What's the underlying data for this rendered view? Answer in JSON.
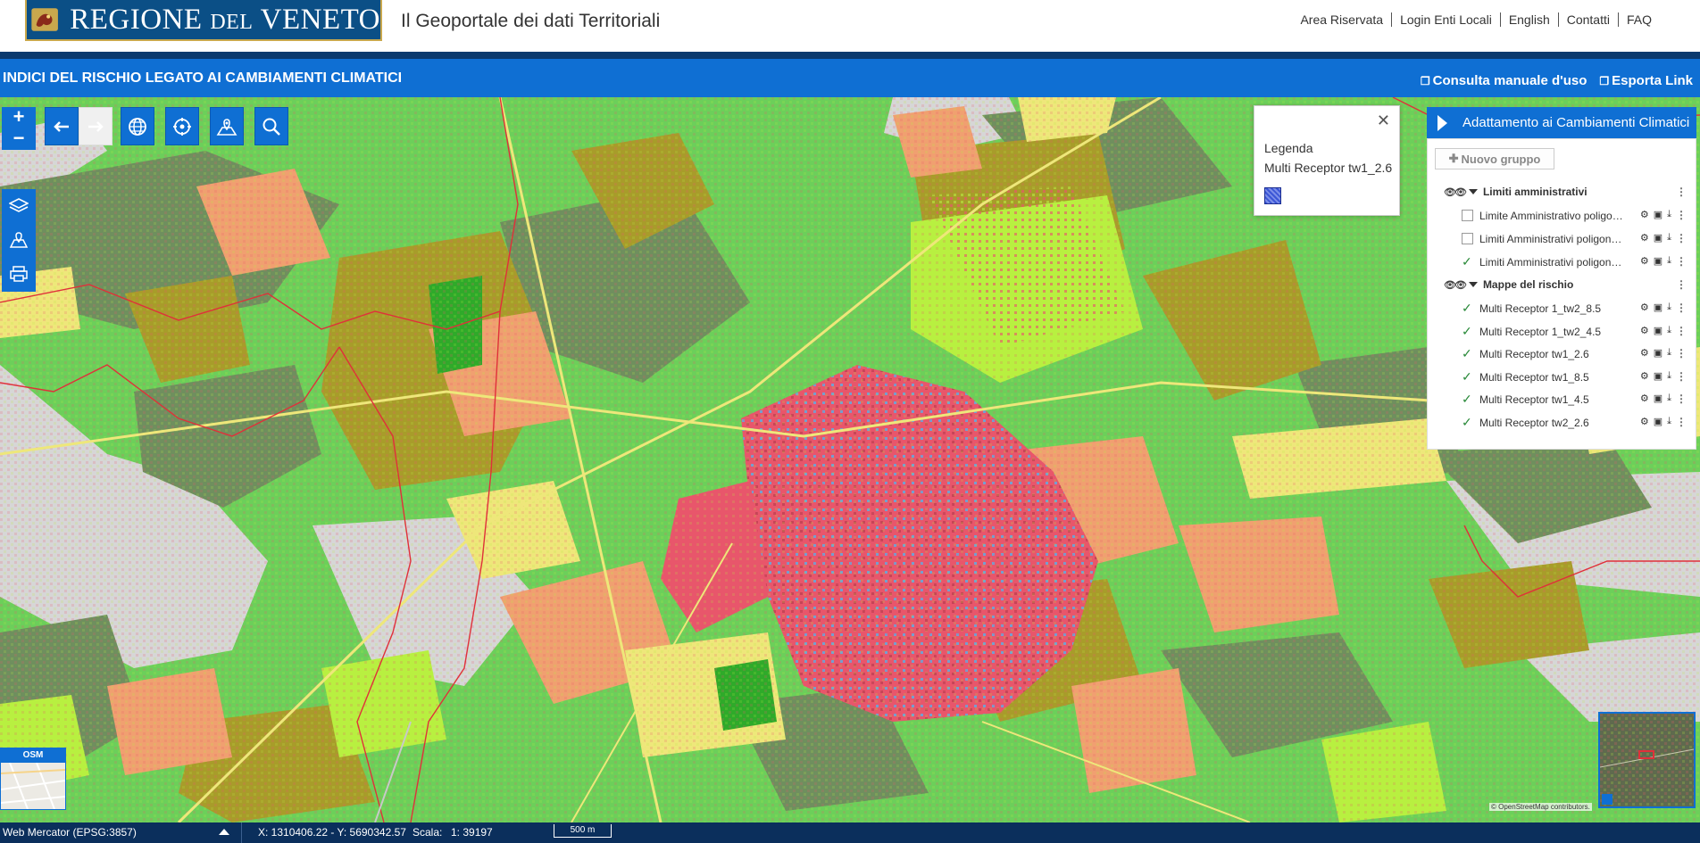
{
  "header": {
    "logo_text_1": "REGIONE",
    "logo_text_2": "DEL",
    "logo_text_3": "VENETO",
    "portal_title": "Il Geoportale dei dati Territoriali",
    "links": [
      "Area Riservata",
      "Login Enti Locali",
      "English",
      "Contatti",
      "FAQ"
    ]
  },
  "titlebar": {
    "title": "INDICI DEL RISCHIO LEGATO AI CAMBIAMENTI CLIMATICI",
    "manual": "Consulta manuale d'uso",
    "export": "Esporta Link"
  },
  "toolbar": {
    "zoom_in": "+",
    "zoom_out": "−",
    "icons": [
      "arrow-left-icon",
      "arrow-right-icon",
      "globe-icon",
      "crosshair-icon",
      "map-pin-icon",
      "search-icon"
    ],
    "side_icons": [
      "layers-icon",
      "map-edit-icon",
      "printer-icon"
    ]
  },
  "legend": {
    "title": "Legenda",
    "layer": "Multi Receptor tw1_2.6",
    "swatch_color": "#3b56d6"
  },
  "panel": {
    "title": "Adattamento ai Cambiamenti Climatici",
    "new_group": "Nuovo gruppo",
    "groups": [
      {
        "name": "Limiti amministrativi",
        "layers": [
          {
            "name": "Limite Amministrativo poligono regionale",
            "checked": false
          },
          {
            "name": "Limiti Amministrativi poligoni provinciali",
            "checked": false
          },
          {
            "name": "Limiti Amministrativi poligoni comunali",
            "checked": true
          }
        ]
      },
      {
        "name": "Mappe del rischio",
        "layers": [
          {
            "name": "Multi Receptor 1_tw2_8.5",
            "checked": true
          },
          {
            "name": "Multi Receptor 1_tw2_4.5",
            "checked": true
          },
          {
            "name": "Multi Receptor tw1_2.6",
            "checked": true
          },
          {
            "name": "Multi Receptor tw1_8.5",
            "checked": true
          },
          {
            "name": "Multi Receptor tw1_4.5",
            "checked": true
          },
          {
            "name": "Multi Receptor tw2_2.6",
            "checked": true
          }
        ]
      }
    ]
  },
  "map": {
    "basemap_label": "OSM",
    "attribution": "© OpenStreetMap contributors."
  },
  "footer": {
    "projection": "Web Mercator (EPSG:3857)",
    "coordinates": "X: 1310406.22 - Y: 5690342.57",
    "scale_label": "Scala:",
    "scale_value": "1: 39197",
    "scalebar": "500 m"
  },
  "colors": {
    "brand_blue": "#0f6fd3",
    "dark_blue": "#0b2f5c",
    "risk_red": "#e8566b",
    "risk_orange": "#f0a070",
    "risk_yellow": "#eee77a",
    "risk_lime": "#b8f040",
    "risk_green": "#6ccf5a",
    "risk_dark": "#6f8f5e",
    "risk_olive": "#a89c2a",
    "risk_blue": "#5ab0e8",
    "neutral_grey": "#d6d6d6"
  }
}
